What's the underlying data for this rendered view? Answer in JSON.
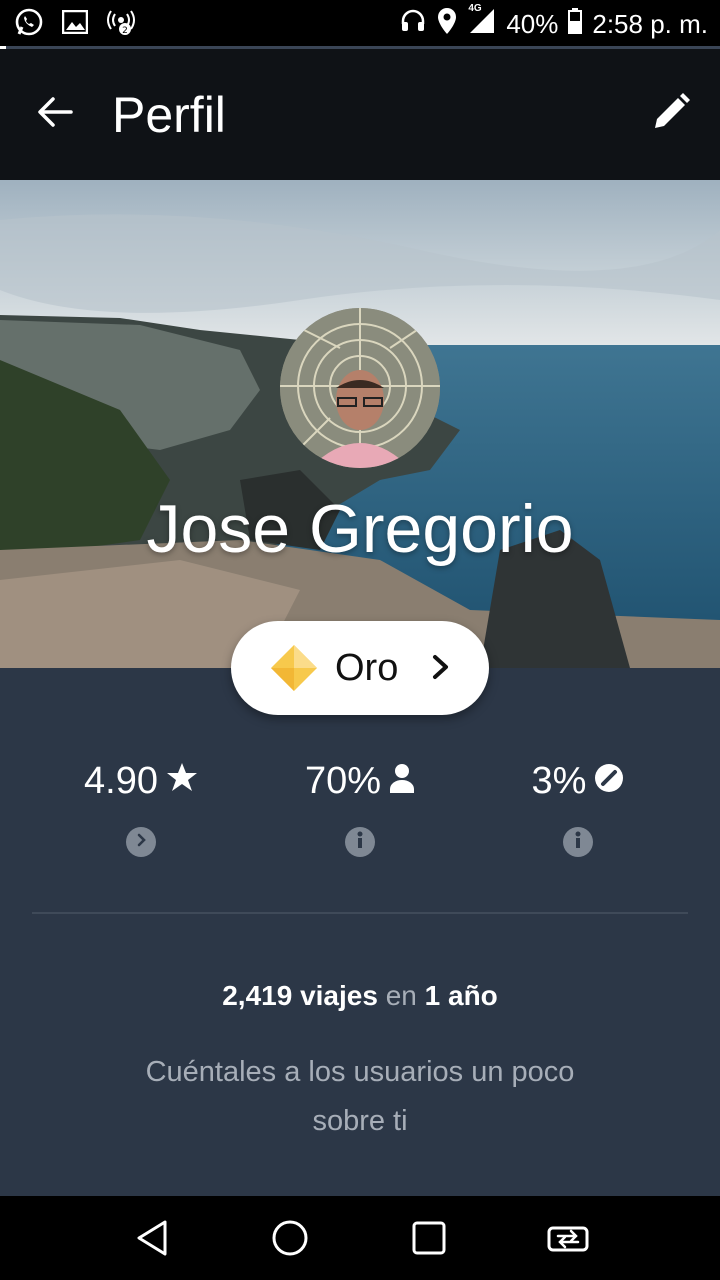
{
  "status_bar": {
    "left_icons": [
      "whatsapp-icon",
      "gallery-icon",
      "hotspot-icon"
    ],
    "network": "4G",
    "battery": "40%",
    "time": "2:58 p. m."
  },
  "app_bar": {
    "title": "Perfil",
    "back_icon": "arrow-back-icon",
    "edit_icon": "pencil-icon"
  },
  "profile": {
    "name": "Jose Gregorio",
    "tier": "Oro",
    "tier_color": "#f5c74a"
  },
  "stats": [
    {
      "value": "4.90",
      "icon": "star-icon",
      "sub_icon": "chevron-right-icon"
    },
    {
      "value": "70%",
      "icon": "person-icon",
      "sub_icon": "info-icon"
    },
    {
      "value": "3%",
      "icon": "cancel-icon",
      "sub_icon": "info-icon"
    }
  ],
  "trips": {
    "count": "2,419 viajes",
    "connector": "en",
    "duration": "1 año"
  },
  "about_prompt": "Cuéntales a los usuarios un poco sobre ti",
  "nav": [
    "back-triangle-icon",
    "home-circle-icon",
    "recents-square-icon",
    "switch-app-icon"
  ]
}
